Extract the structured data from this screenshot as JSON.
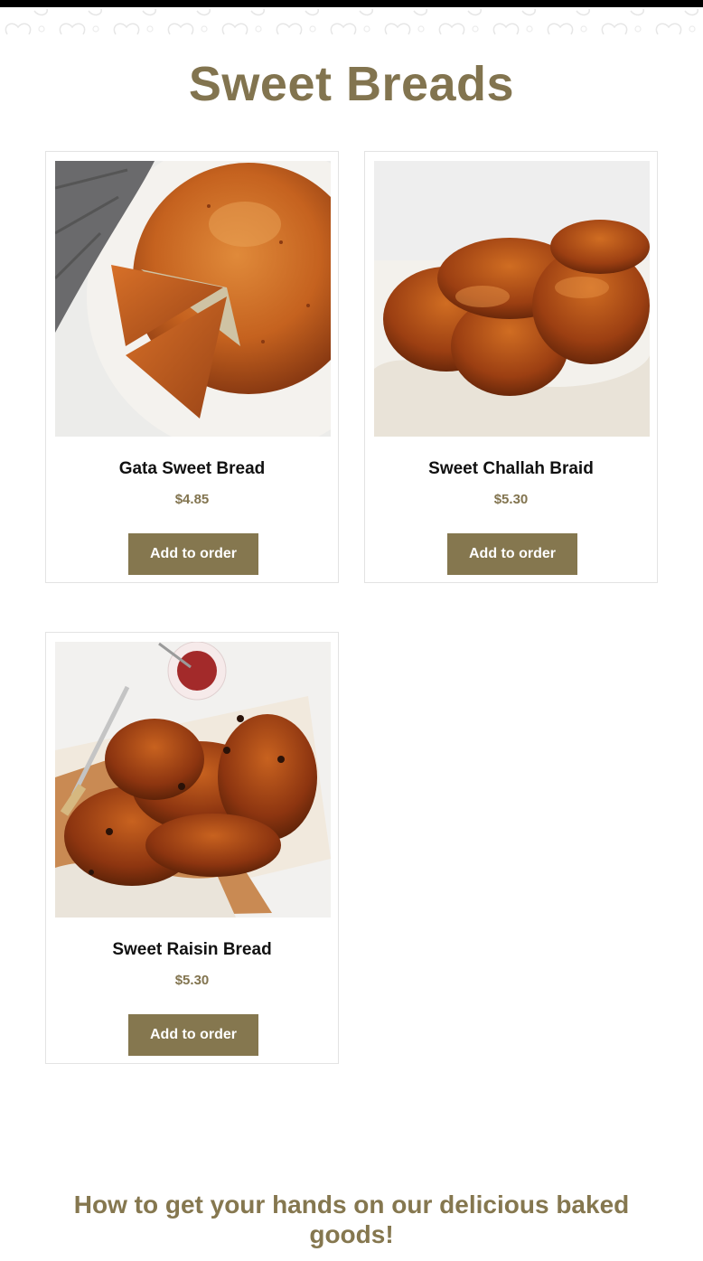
{
  "page": {
    "title": "Sweet Breads",
    "accent_color": "#85774f"
  },
  "products": [
    {
      "name": "Gata Sweet Bread",
      "price": "$4.85",
      "button_label": "Add to order",
      "image_icon": "round-sweet-bread-photo"
    },
    {
      "name": "Sweet Challah Braid",
      "price": "$5.30",
      "button_label": "Add to order",
      "image_icon": "braided-challah-photo"
    },
    {
      "name": "Sweet Raisin Bread",
      "price": "$5.30",
      "button_label": "Add to order",
      "image_icon": "raisin-braid-photo"
    }
  ],
  "info_section": {
    "heading": "How to get your hands on our delicious baked goods!"
  }
}
